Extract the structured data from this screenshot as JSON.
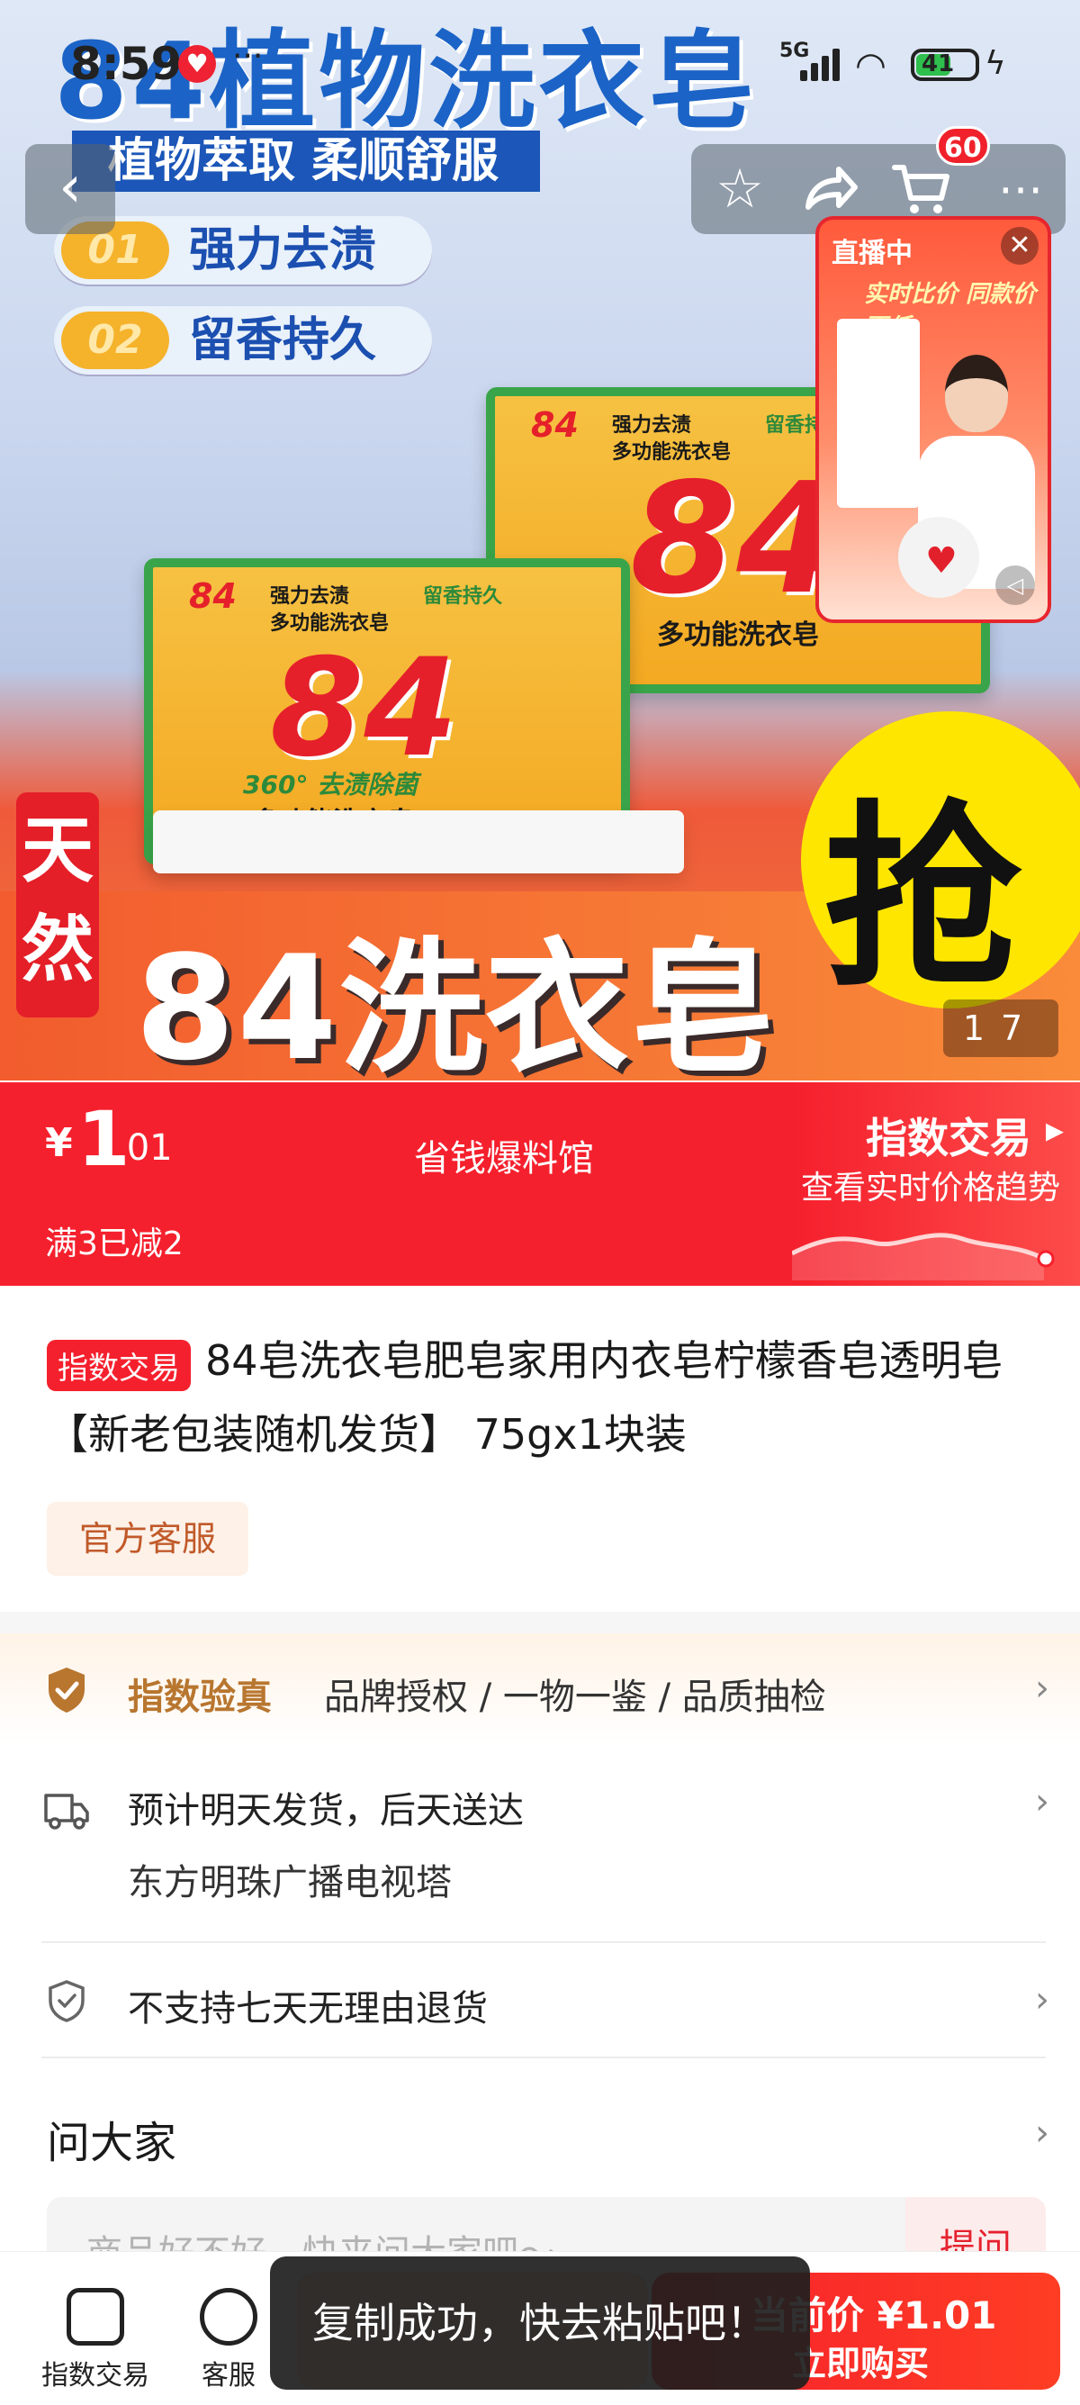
{
  "status_bar": {
    "time": "8:59",
    "network": "5G",
    "battery": "41"
  },
  "hero": {
    "title": "84植物洗衣皂",
    "subtitle": "植物萃取 柔顺舒服",
    "features": [
      {
        "num": "01",
        "text": "强力去渍"
      },
      {
        "num": "02",
        "text": "留香持久"
      }
    ],
    "soap_brand": "84",
    "soap_label_top": "强力去渍",
    "soap_label_scent": "留香持久",
    "soap_type": "多功能洗衣皂",
    "soap_claim": "360° 去渍除菌",
    "side_badge": "天然",
    "bottom_text": "84洗衣皂",
    "grab": "抢",
    "image_index": "1",
    "image_total": "7"
  },
  "nav": {
    "back": "‹",
    "cart_count": "60"
  },
  "live": {
    "tag": "直播中",
    "promo": "实时比价 同款价更低",
    "close": "✕"
  },
  "price_bar": {
    "currency": "¥",
    "price_int": "1",
    "price_dec": ".01",
    "shop": "省钱爆料馆",
    "promo": "满3已减2",
    "index_label": "指数交易",
    "trend_label": "查看实时价格趋势"
  },
  "product": {
    "tag": "指数交易",
    "title": "84皂洗衣皂肥皂家用内衣皂柠檬香皂透明皂【新老包装随机发货】 75gx1块装",
    "service_chip": "官方客服"
  },
  "verify": {
    "title": "指数验真",
    "desc": "品牌授权 / 一物一鉴 / 品质抽检"
  },
  "shipping": {
    "line1": "预计明天发货，后天送达",
    "line2": "东方明珠广播电视塔"
  },
  "returns": {
    "text": "不支持七天无理由退货"
  },
  "qa": {
    "title": "问大家",
    "placeholder": "商品好不好，快来问大家吧～",
    "button": "提问"
  },
  "bottom_bar": {
    "item1": "指数交易",
    "item2": "客服",
    "buy_line1": "当前价 ¥1.01",
    "buy_line2": "立即购买"
  },
  "toast": {
    "text": "复制成功，快去粘贴吧！"
  },
  "colors": {
    "brand_red": "#f5202d",
    "verify_gold": "#b8762f"
  }
}
